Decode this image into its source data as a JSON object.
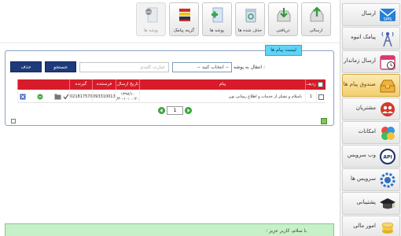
{
  "nav": {
    "items": [
      {
        "label": "ارسال",
        "icon": "sms-envelope-icon",
        "active": false
      },
      {
        "label": "پیامک انبوه",
        "icon": "antenna-icon",
        "active": false
      },
      {
        "label": "ارسال زماندار",
        "icon": "calendar-icon",
        "active": false
      },
      {
        "label": "صندوق پیام ها",
        "icon": "inbox-icon",
        "active": true
      },
      {
        "label": "مشتریان",
        "icon": "users-icon",
        "active": false
      },
      {
        "label": "امکانات",
        "icon": "puzzle-icon",
        "active": false
      },
      {
        "label": "وب سرویس",
        "icon": "api-icon",
        "active": false
      },
      {
        "label": "سرویس ها",
        "icon": "gear-icon",
        "active": false
      },
      {
        "label": "پشتیبانی",
        "icon": "graduation-cap-icon",
        "active": false
      },
      {
        "label": "امور مالی",
        "icon": "coins-icon",
        "active": false
      }
    ]
  },
  "toolbar": {
    "buttons": [
      {
        "label": "ارسالی",
        "icon": "outbox-icon",
        "enabled": true
      },
      {
        "label": "دریافتی",
        "icon": "inbox-download-icon",
        "enabled": true
      },
      {
        "label": "حذف شده ها",
        "icon": "recycle-bin-icon",
        "enabled": true
      },
      {
        "label": "پوشه ها",
        "icon": "add-folder-icon",
        "enabled": true
      },
      {
        "label": "گزینه پیامک",
        "icon": "books-icon",
        "enabled": true
      },
      {
        "label": "پوشه ها",
        "icon": "sms-folder-icon",
        "enabled": false
      }
    ]
  },
  "panel": {
    "title": "لیست پیام ها",
    "move_label": "انتقال به پوشه :",
    "folder_select_value": "-- انتخاب کنید --",
    "search_placeholder": "عبارت کلیدی",
    "search_button": "جستجو",
    "delete_button": "حذف"
  },
  "table": {
    "headers": {
      "row": "ردیف",
      "message": "پیام",
      "date": "تاریخ ارسال",
      "sender": "فرستنده",
      "receiver": "گیرنده"
    },
    "rows": [
      {
        "index": "1",
        "message": "باسلام و تشکر از خدمات و اطلاع رسانی تون",
        "date_line1": "۱۳۹۷/۱۰",
        "date_line2": "/۳۰-۱۰:۰۰:۲۰",
        "sender": "09331001391",
        "receiver": "02181757000"
      }
    ],
    "page": "1"
  },
  "bottom": {
    "welcome": "با سلام، کاربر عزیز :"
  },
  "colors": {
    "accent": "#d81b2a",
    "button": "#1f3a7a",
    "panel_title": "#5fd4f5",
    "active_nav": "#f4cf6f",
    "notice": "#c8f0c8"
  }
}
